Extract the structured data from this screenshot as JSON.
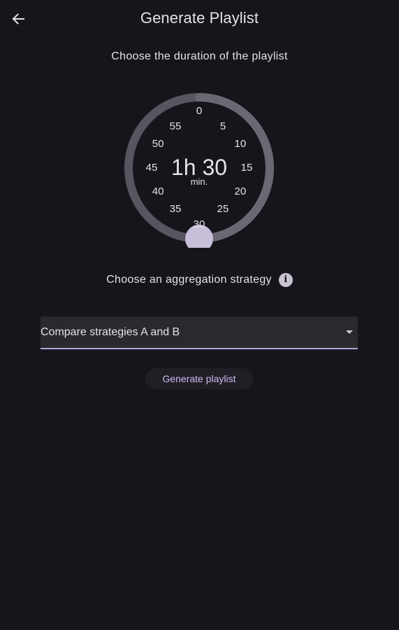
{
  "header": {
    "title": "Generate Playlist",
    "back_icon": "arrow-left-icon"
  },
  "duration": {
    "label": "Choose the duration of the playlist",
    "ticks": [
      "0",
      "5",
      "10",
      "15",
      "20",
      "25",
      "30",
      "35",
      "40",
      "45",
      "50",
      "55"
    ],
    "hours": "1h",
    "minutes": "30",
    "display": "1h 30",
    "unit": "min.",
    "selected_minutes": 30,
    "dial_total_minutes": 60
  },
  "aggregation": {
    "label": "Choose an aggregation strategy",
    "info_icon": "info-icon",
    "selected_value": "Compare strategies A and B"
  },
  "actions": {
    "generate_label": "Generate playlist"
  },
  "colors": {
    "background": "#16151b",
    "accent": "#b7a6de",
    "button_text": "#cdb9f3",
    "dial_track": "#58555e",
    "dial_thumb": "#c8bfdb"
  }
}
